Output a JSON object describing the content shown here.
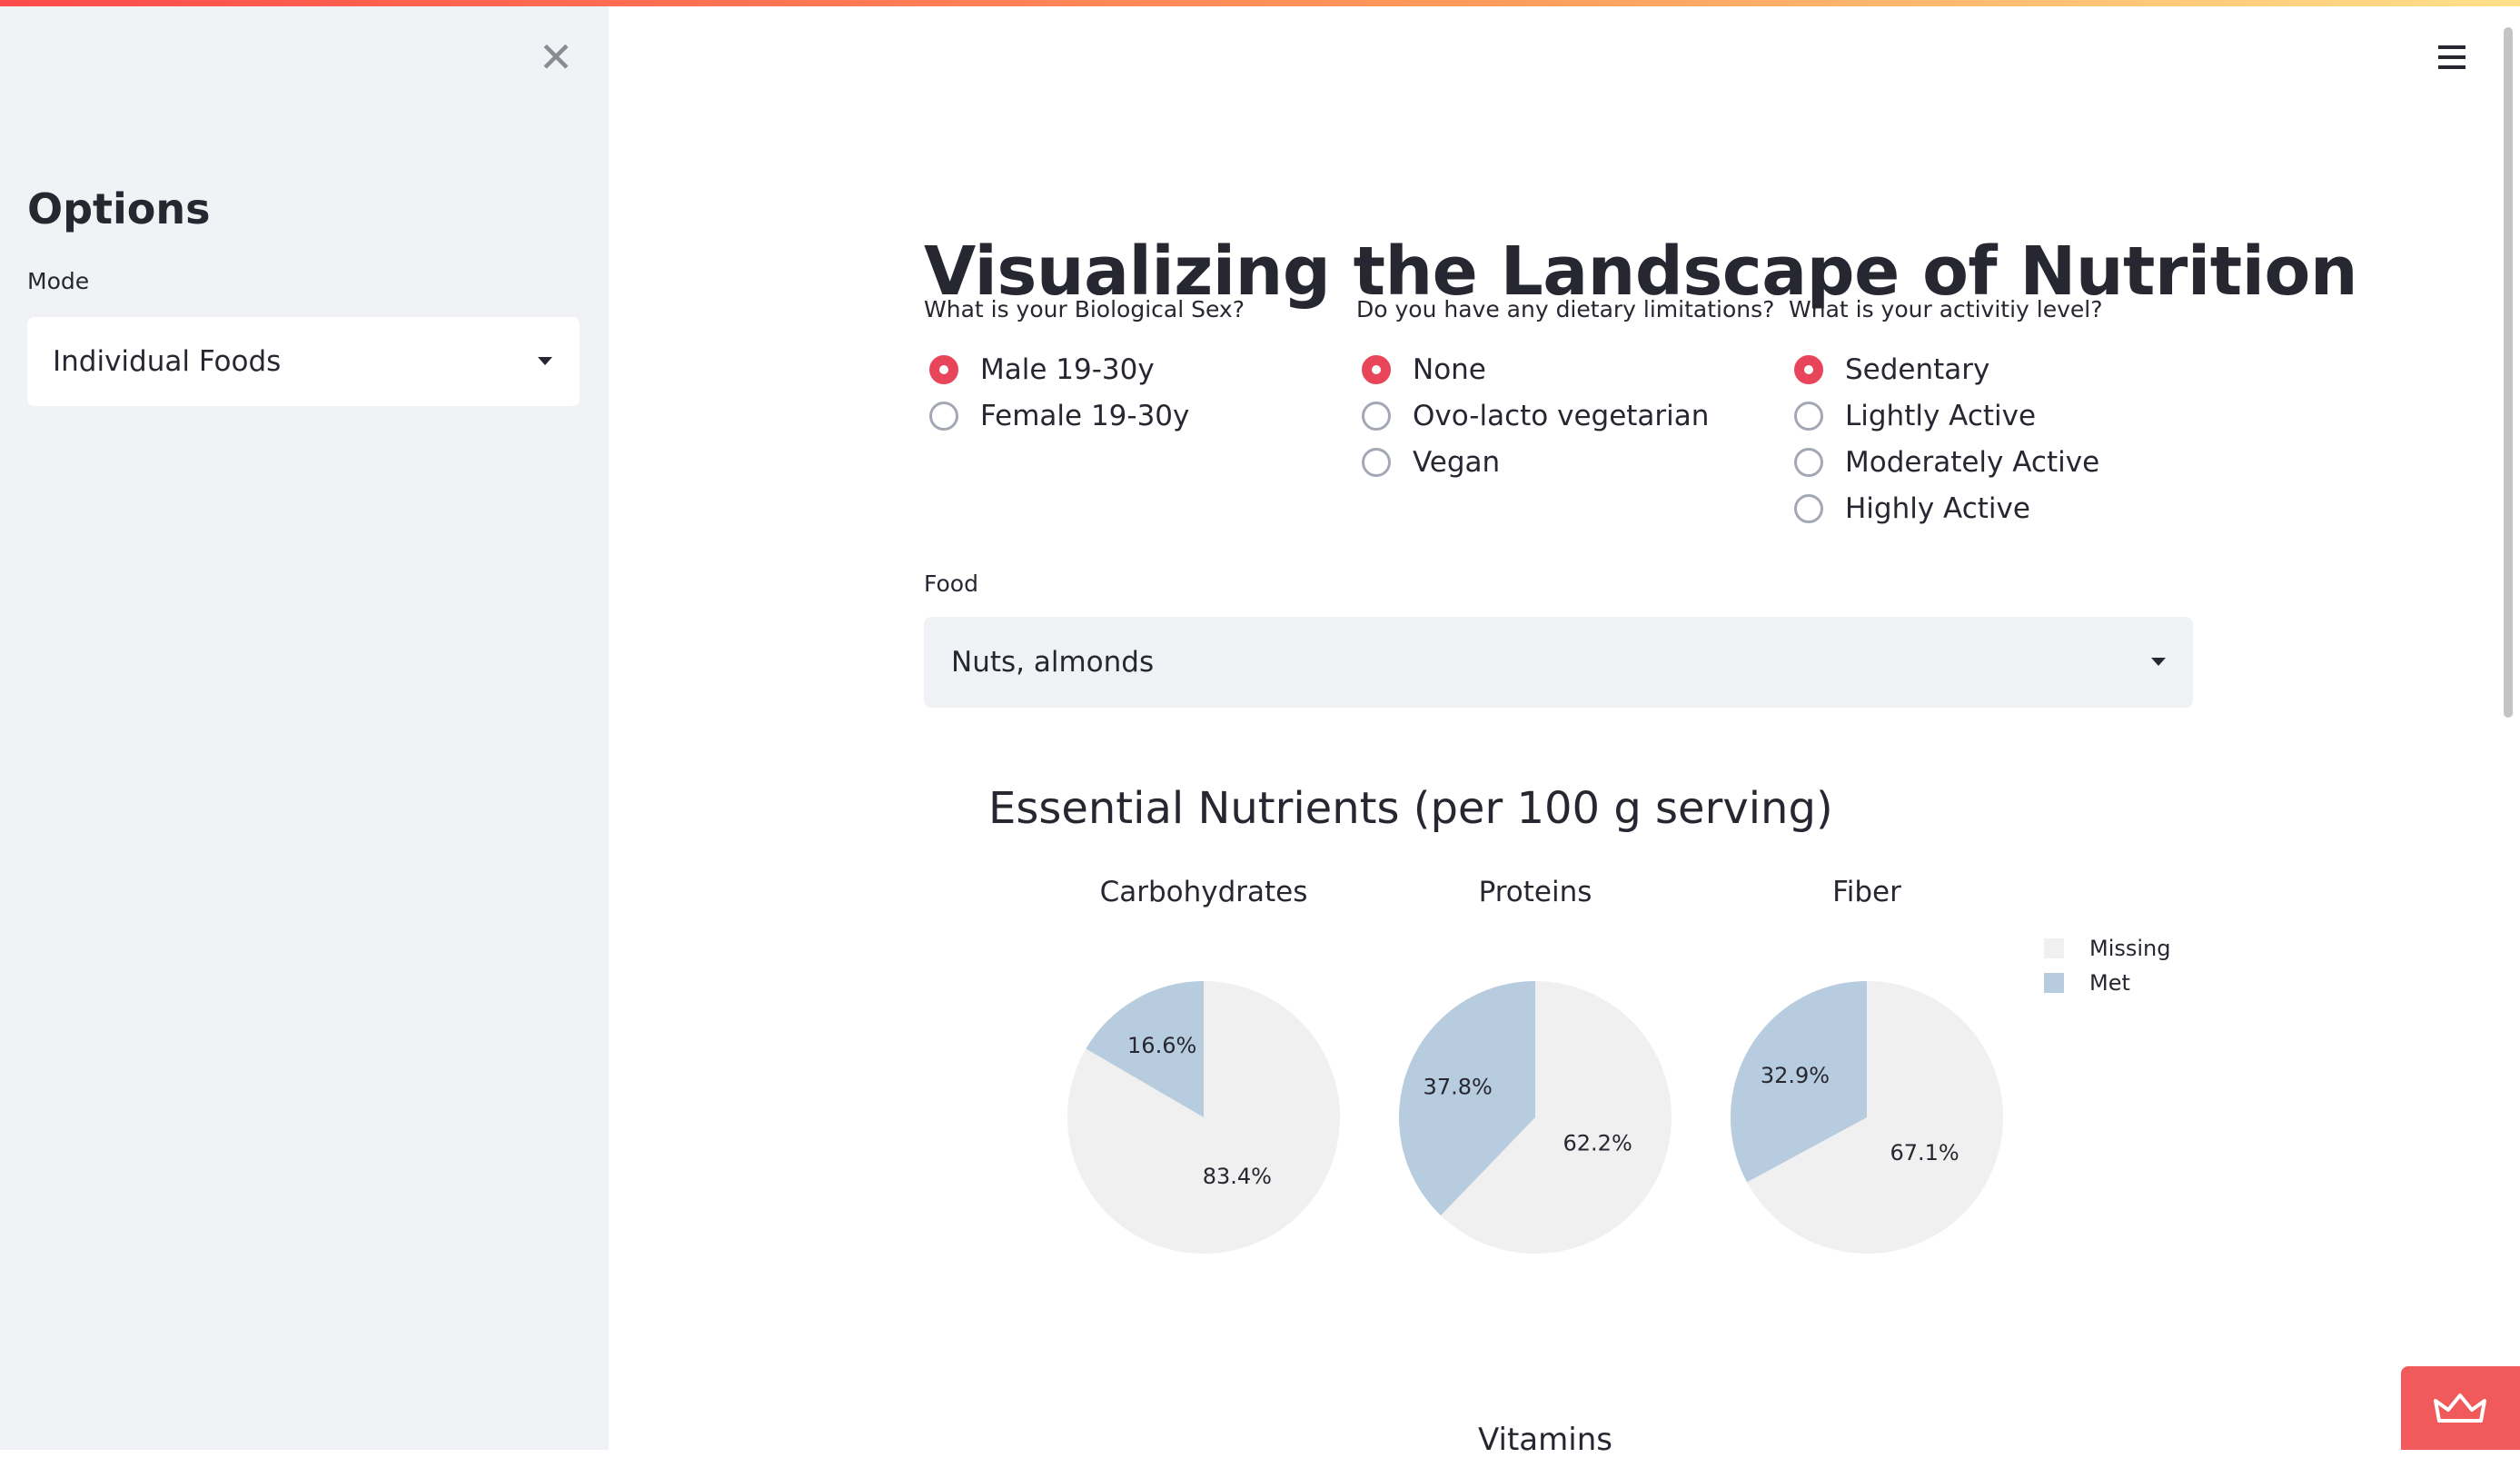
{
  "sidebar": {
    "title": "Options",
    "mode_label": "Mode",
    "mode_value": "Individual Foods"
  },
  "main": {
    "title": "Visualizing the Landscape of Nutrition",
    "sex": {
      "question": "What is your Biological Sex?",
      "options": [
        "Male 19-30y",
        "Female 19-30y"
      ],
      "selected": 0
    },
    "diet": {
      "question": "Do you have any dietary limitations?",
      "options": [
        "None",
        "Ovo-lacto vegetarian",
        "Vegan"
      ],
      "selected": 0
    },
    "activity": {
      "question": "What is your activitiy level?",
      "options": [
        "Sedentary",
        "Lightly Active",
        "Moderately Active",
        "Highly Active"
      ],
      "selected": 0
    },
    "food_label": "Food",
    "food_value": "Nuts, almonds",
    "next_section_title": "Vitamins"
  },
  "chart_data": {
    "type": "pie",
    "title": "Essential Nutrients (per 100 g serving)",
    "legend": [
      "Missing",
      "Met"
    ],
    "colors": {
      "Missing": "#f0f0f0",
      "Met": "#b8cce0"
    },
    "legend_placement": "top-right",
    "pies": [
      {
        "name": "Carbohydrates",
        "met": 16.6,
        "missing": 83.4
      },
      {
        "name": "Proteins",
        "met": 37.8,
        "missing": 62.2
      },
      {
        "name": "Fiber",
        "met": 32.9,
        "missing": 67.1
      }
    ]
  },
  "icons": {
    "close": "close-icon",
    "menu": "hamburger-menu-icon",
    "badge": "crown-icon"
  },
  "colors": {
    "accent": "#e8445a",
    "sidebar_bg": "#f0f2f6"
  }
}
